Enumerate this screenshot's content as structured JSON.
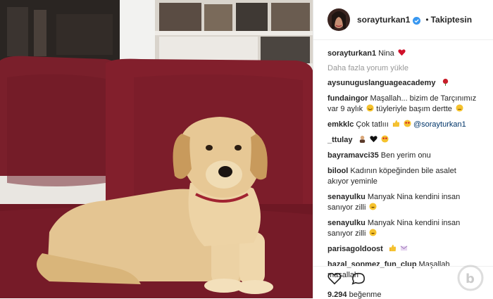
{
  "post": {
    "author": "sorayturkan1",
    "follow_status": "Takiptesin",
    "caption_user": "sorayturkan1",
    "caption_text": "Nina",
    "load_more": "Daha fazla yorum yükle",
    "likes_count": "9.294",
    "likes_label": "beğenme"
  },
  "comments": [
    {
      "user": "aysunuguslanguageacademy",
      "text": ""
    },
    {
      "user": "fundaingor",
      "text": "Maşallah... bizim de Tarçınımız var 9 aylık",
      "text2": "tüyleriyle başım dertte"
    },
    {
      "user": "emkklc",
      "text": "Çok tatlııı",
      "mention": "@sorayturkan1"
    },
    {
      "user": "_ttulay",
      "text": ""
    },
    {
      "user": "bayramavci35",
      "text": "Ben yerim onu"
    },
    {
      "user": "bilool",
      "text": "Kadının köpeğinden bile asalet akıyor yeminle"
    },
    {
      "user": "senayulku",
      "text": "Manyak Nina kendini insan sanıyor zilli"
    },
    {
      "user": "senayulku",
      "text": "Manyak Nina kendini insan sanıyor zilli"
    },
    {
      "user": "parisagoldoost",
      "text": ""
    },
    {
      "user": "hazal_sonmez_fun_clup",
      "text": "Maşallah maşallah"
    }
  ],
  "icons": [
    "heart-icon",
    "comment-icon",
    "verified-badge-icon"
  ],
  "colors": {
    "sofa": "#7a1f2b",
    "dog": "#e3c38f",
    "verified": "#3897f0"
  }
}
